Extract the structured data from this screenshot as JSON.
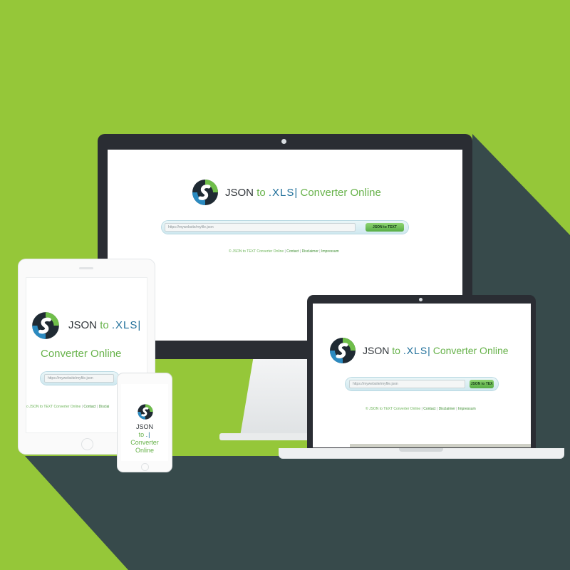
{
  "page": {
    "title_json": "JSON",
    "title_to": "to",
    "title_ext": ".XLS",
    "title_bar": "|",
    "title_converter": "Converter Online",
    "url_placeholder": "https://mywebsite/myfile.json",
    "button_label": "JSON to TEXT",
    "button_label_laptop": "JSON to TEX",
    "footer_copyright": "© JSON to TEXT Converter Online",
    "footer_copyright_tablet": "o JSON to TEXT Converter Online",
    "footer_sep": "|",
    "footer_contact": "Contact",
    "footer_disclaimer": "Disclaimer",
    "footer_disclaimer_tablet": "Disclai",
    "footer_impressum": "Impressum",
    "phone_ext": ".|"
  },
  "colors": {
    "background": "#95c739",
    "shadow": "#374a4b",
    "device_frame": "#2a2d33",
    "accent_green": "#67b24a",
    "accent_blue": "#1e6e99"
  },
  "icons": {
    "logo": "circular-sync-arrows-icon"
  }
}
